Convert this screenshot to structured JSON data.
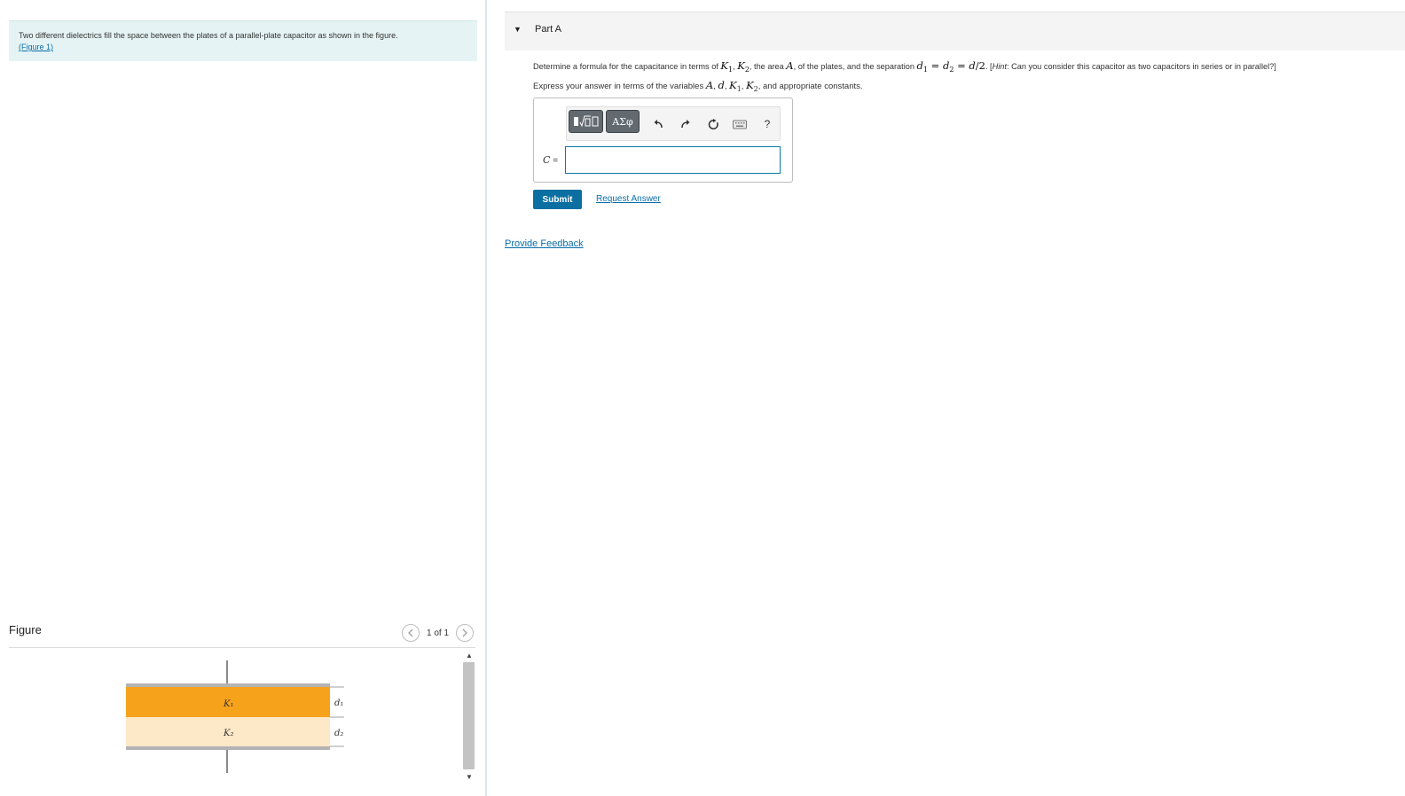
{
  "problem": {
    "intro_text": "Two different dielectrics fill the space between the plates of a parallel-plate capacitor as shown in the figure.",
    "figure_link": "(Figure 1)"
  },
  "figure_panel": {
    "title": "Figure",
    "counter": "1 of 1",
    "prev_icon": "chevron-left-icon",
    "next_icon": "chevron-right-icon",
    "diagram": {
      "k1_label": "K₁",
      "k2_label": "K₂",
      "d1_label": "d₁",
      "d2_label": "d₂",
      "colors": {
        "k1_fill": "#f7a21b",
        "k2_fill": "#fde8c8",
        "plate": "#b3b3b3"
      }
    }
  },
  "part_a": {
    "label": "Part A",
    "question": {
      "t1": "Determine a formula for the capacitance in terms of ",
      "K1": "K",
      "K1_sub": "1",
      "t2": ", ",
      "K2": "K",
      "K2_sub": "2",
      "t3": ", the area ",
      "A": "A",
      "t4": ", of the plates, and the separation ",
      "d1": "d",
      "d1_sub": "1",
      "eq1": " = ",
      "d2": "d",
      "d2_sub": "2",
      "eq2": " = ",
      "d": "d",
      "half": "/2",
      "t5": ". [",
      "hint_label": "Hint",
      "hint_text": ": Can you consider this capacitor as two capacitors in series or in parallel?]"
    },
    "express": {
      "t1": "Express your answer in terms of the variables ",
      "A": "A",
      "c1": ", ",
      "d": "d",
      "c2": ", ",
      "K1": "K",
      "K1_sub": "1",
      "c3": ", ",
      "K2": "K",
      "K2_sub": "2",
      "t2": ", and appropriate constants."
    },
    "toolbar": {
      "templates_icon": "math-templates-icon",
      "symbols_label": "ΑΣφ",
      "undo_icon": "undo-icon",
      "redo_icon": "redo-icon",
      "reset_icon": "reset-icon",
      "keyboard_icon": "keyboard-icon",
      "help_label": "?"
    },
    "answer_label_var": "C",
    "answer_label_eq": " =",
    "answer_value": "",
    "submit_label": "Submit",
    "request_label": "Request Answer"
  },
  "feedback_label": "Provide Feedback"
}
